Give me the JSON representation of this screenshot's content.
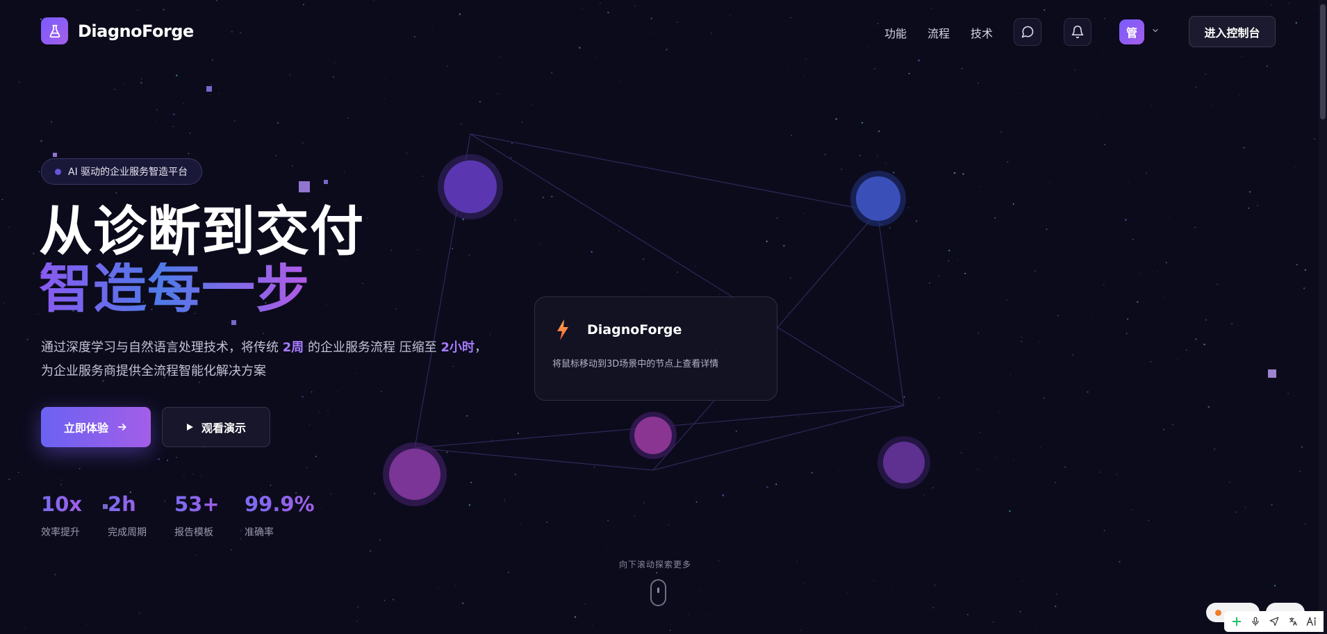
{
  "brand": {
    "name": "DiagnoForge"
  },
  "nav": {
    "links": [
      "功能",
      "流程",
      "技术"
    ]
  },
  "header": {
    "avatar_text": "管",
    "console_label": "进入控制台"
  },
  "hero": {
    "badge": "AI 驱动的企业服务智造平台",
    "title_line1": "从诊断到交付",
    "title_line2": "智造每一步",
    "desc_part1": "通过深度学习与自然语言处理技术，将传统 ",
    "desc_hl1": "2周",
    "desc_part2": " 的企业服务流程 压缩至 ",
    "desc_hl2": "2小时",
    "desc_part3": "，",
    "desc_line2": "为企业服务商提供全流程智能化解决方案",
    "primary_label": "立即体验",
    "secondary_label": "观看演示"
  },
  "stats": [
    {
      "value": "10x",
      "label": "效率提升"
    },
    {
      "value": "2h",
      "label": "完成周期"
    },
    {
      "value": "53+",
      "label": "报告模板"
    },
    {
      "value": "99.9%",
      "label": "准确率"
    }
  ],
  "card": {
    "title": "DiagnoForge",
    "desc": "将鼠标移动到3D场景中的节点上查看详情"
  },
  "scroll_hint": "向下滚动探索更多",
  "colors": {
    "accent": "#7a5cff",
    "accent2": "#a35ee8",
    "background": "#0c0b1c"
  },
  "icons": [
    "flask-icon",
    "chat-icon",
    "bell-icon",
    "chevron-down-icon",
    "arrow-right-icon",
    "play-icon",
    "bolt-icon",
    "mouse-icon"
  ]
}
